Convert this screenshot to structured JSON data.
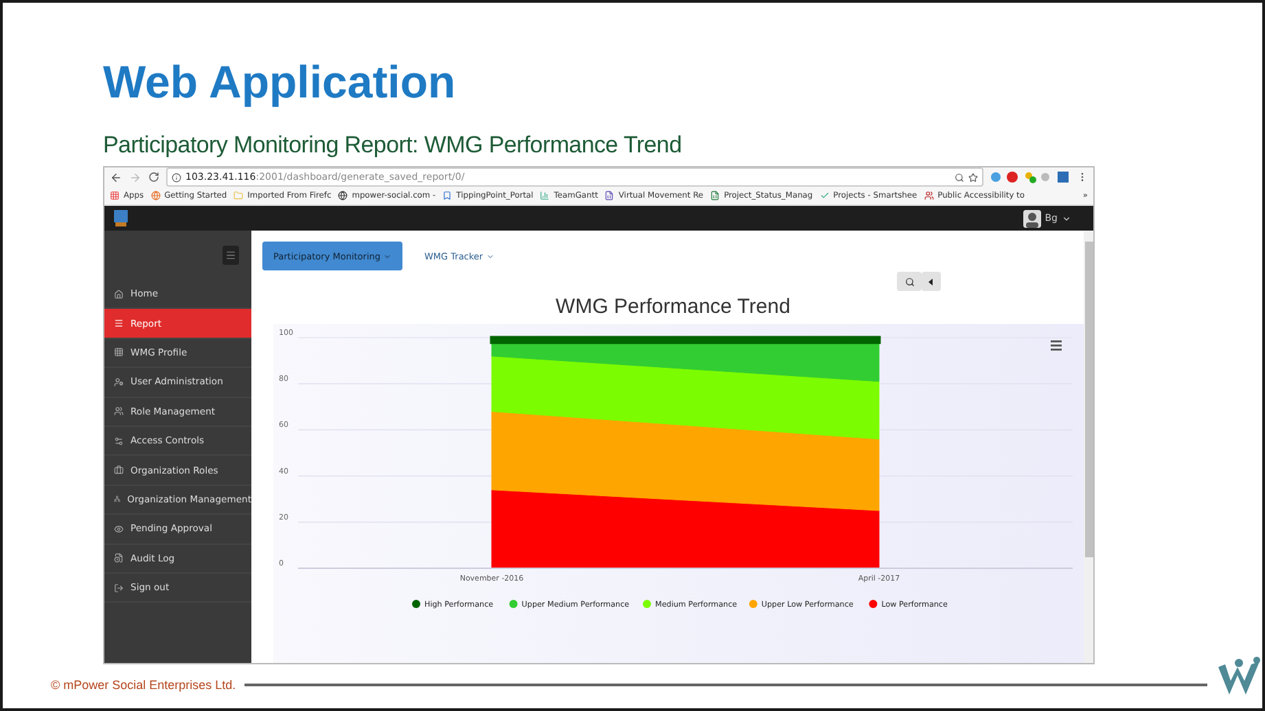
{
  "slide": {
    "title": "Web Application",
    "subtitle": "Participatory Monitoring Report: WMG Performance Trend",
    "footer": "© mPower Social Enterprises Ltd."
  },
  "browser": {
    "url_host": "103.23.41.116",
    "url_path": ":2001/dashboard/generate_saved_report/0/",
    "bookmarks": [
      {
        "label": "Apps"
      },
      {
        "label": "Getting Started"
      },
      {
        "label": "Imported From Firefc"
      },
      {
        "label": "mpower-social.com -"
      },
      {
        "label": "TippingPoint_Portal"
      },
      {
        "label": "TeamGantt"
      },
      {
        "label": "Virtual Movement Re"
      },
      {
        "label": "Project_Status_Manag"
      },
      {
        "label": "Projects - Smartshee"
      },
      {
        "label": "Public Accessibility to"
      }
    ],
    "overflow": "»"
  },
  "app": {
    "user": "Bg",
    "sidebar": [
      {
        "label": "Home",
        "selected": false
      },
      {
        "label": "Report",
        "selected": true
      },
      {
        "label": "WMG Profile",
        "selected": false
      },
      {
        "label": "User Administration",
        "selected": false
      },
      {
        "label": "Role Management",
        "selected": false
      },
      {
        "label": "Access Controls",
        "selected": false
      },
      {
        "label": "Organization Roles",
        "selected": false
      },
      {
        "label": "Organization Management",
        "selected": false
      },
      {
        "label": "Pending Approval",
        "selected": false
      },
      {
        "label": "Audit Log",
        "selected": false
      },
      {
        "label": "Sign out",
        "selected": false
      }
    ],
    "tabs": [
      {
        "label": "Participatory Monitoring",
        "selected": true
      },
      {
        "label": "WMG Tracker",
        "selected": false
      }
    ],
    "chart_data": {
      "type": "area",
      "title": "WMG Performance Trend",
      "categories": [
        "November -2016",
        "April -2017"
      ],
      "stacked": true,
      "grid": true,
      "legend": true,
      "ylim": [
        0,
        100
      ],
      "yticks": [
        0,
        20,
        40,
        60,
        80,
        100
      ],
      "series": [
        {
          "name": "High Performance",
          "color": "#006400",
          "values": [
            2,
            2
          ]
        },
        {
          "name": "Upper Medium Performance",
          "color": "#32cd32",
          "values": [
            6,
            17
          ]
        },
        {
          "name": "Medium Performance",
          "color": "#7cfc00",
          "values": [
            24,
            25
          ]
        },
        {
          "name": "Upper Low Performance",
          "color": "#ffa500",
          "values": [
            34,
            31
          ]
        },
        {
          "name": "Low Performance",
          "color": "#ff0000",
          "values": [
            34,
            25
          ]
        }
      ]
    }
  }
}
